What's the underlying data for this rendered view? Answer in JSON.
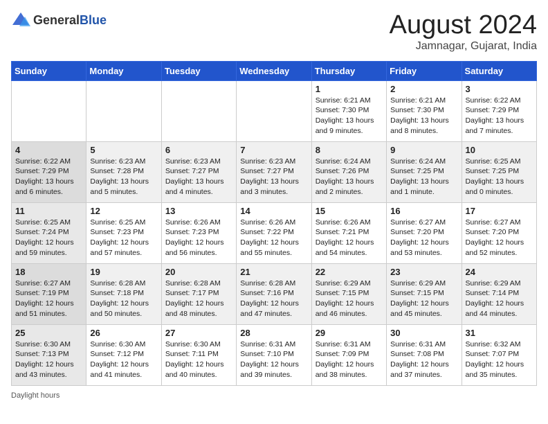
{
  "logo": {
    "general": "General",
    "blue": "Blue"
  },
  "title": "August 2024",
  "subtitle": "Jamnagar, Gujarat, India",
  "days_of_week": [
    "Sunday",
    "Monday",
    "Tuesday",
    "Wednesday",
    "Thursday",
    "Friday",
    "Saturday"
  ],
  "weeks": [
    [
      {
        "day": "",
        "info": ""
      },
      {
        "day": "",
        "info": ""
      },
      {
        "day": "",
        "info": ""
      },
      {
        "day": "",
        "info": ""
      },
      {
        "day": "1",
        "info": "Sunrise: 6:21 AM\nSunset: 7:30 PM\nDaylight: 13 hours and 9 minutes."
      },
      {
        "day": "2",
        "info": "Sunrise: 6:21 AM\nSunset: 7:30 PM\nDaylight: 13 hours and 8 minutes."
      },
      {
        "day": "3",
        "info": "Sunrise: 6:22 AM\nSunset: 7:29 PM\nDaylight: 13 hours and 7 minutes."
      }
    ],
    [
      {
        "day": "4",
        "info": "Sunrise: 6:22 AM\nSunset: 7:29 PM\nDaylight: 13 hours and 6 minutes."
      },
      {
        "day": "5",
        "info": "Sunrise: 6:23 AM\nSunset: 7:28 PM\nDaylight: 13 hours and 5 minutes."
      },
      {
        "day": "6",
        "info": "Sunrise: 6:23 AM\nSunset: 7:27 PM\nDaylight: 13 hours and 4 minutes."
      },
      {
        "day": "7",
        "info": "Sunrise: 6:23 AM\nSunset: 7:27 PM\nDaylight: 13 hours and 3 minutes."
      },
      {
        "day": "8",
        "info": "Sunrise: 6:24 AM\nSunset: 7:26 PM\nDaylight: 13 hours and 2 minutes."
      },
      {
        "day": "9",
        "info": "Sunrise: 6:24 AM\nSunset: 7:25 PM\nDaylight: 13 hours and 1 minute."
      },
      {
        "day": "10",
        "info": "Sunrise: 6:25 AM\nSunset: 7:25 PM\nDaylight: 13 hours and 0 minutes."
      }
    ],
    [
      {
        "day": "11",
        "info": "Sunrise: 6:25 AM\nSunset: 7:24 PM\nDaylight: 12 hours and 59 minutes."
      },
      {
        "day": "12",
        "info": "Sunrise: 6:25 AM\nSunset: 7:23 PM\nDaylight: 12 hours and 57 minutes."
      },
      {
        "day": "13",
        "info": "Sunrise: 6:26 AM\nSunset: 7:23 PM\nDaylight: 12 hours and 56 minutes."
      },
      {
        "day": "14",
        "info": "Sunrise: 6:26 AM\nSunset: 7:22 PM\nDaylight: 12 hours and 55 minutes."
      },
      {
        "day": "15",
        "info": "Sunrise: 6:26 AM\nSunset: 7:21 PM\nDaylight: 12 hours and 54 minutes."
      },
      {
        "day": "16",
        "info": "Sunrise: 6:27 AM\nSunset: 7:20 PM\nDaylight: 12 hours and 53 minutes."
      },
      {
        "day": "17",
        "info": "Sunrise: 6:27 AM\nSunset: 7:20 PM\nDaylight: 12 hours and 52 minutes."
      }
    ],
    [
      {
        "day": "18",
        "info": "Sunrise: 6:27 AM\nSunset: 7:19 PM\nDaylight: 12 hours and 51 minutes."
      },
      {
        "day": "19",
        "info": "Sunrise: 6:28 AM\nSunset: 7:18 PM\nDaylight: 12 hours and 50 minutes."
      },
      {
        "day": "20",
        "info": "Sunrise: 6:28 AM\nSunset: 7:17 PM\nDaylight: 12 hours and 48 minutes."
      },
      {
        "day": "21",
        "info": "Sunrise: 6:28 AM\nSunset: 7:16 PM\nDaylight: 12 hours and 47 minutes."
      },
      {
        "day": "22",
        "info": "Sunrise: 6:29 AM\nSunset: 7:15 PM\nDaylight: 12 hours and 46 minutes."
      },
      {
        "day": "23",
        "info": "Sunrise: 6:29 AM\nSunset: 7:15 PM\nDaylight: 12 hours and 45 minutes."
      },
      {
        "day": "24",
        "info": "Sunrise: 6:29 AM\nSunset: 7:14 PM\nDaylight: 12 hours and 44 minutes."
      }
    ],
    [
      {
        "day": "25",
        "info": "Sunrise: 6:30 AM\nSunset: 7:13 PM\nDaylight: 12 hours and 43 minutes."
      },
      {
        "day": "26",
        "info": "Sunrise: 6:30 AM\nSunset: 7:12 PM\nDaylight: 12 hours and 41 minutes."
      },
      {
        "day": "27",
        "info": "Sunrise: 6:30 AM\nSunset: 7:11 PM\nDaylight: 12 hours and 40 minutes."
      },
      {
        "day": "28",
        "info": "Sunrise: 6:31 AM\nSunset: 7:10 PM\nDaylight: 12 hours and 39 minutes."
      },
      {
        "day": "29",
        "info": "Sunrise: 6:31 AM\nSunset: 7:09 PM\nDaylight: 12 hours and 38 minutes."
      },
      {
        "day": "30",
        "info": "Sunrise: 6:31 AM\nSunset: 7:08 PM\nDaylight: 12 hours and 37 minutes."
      },
      {
        "day": "31",
        "info": "Sunrise: 6:32 AM\nSunset: 7:07 PM\nDaylight: 12 hours and 35 minutes."
      }
    ]
  ],
  "footer": "Daylight hours"
}
